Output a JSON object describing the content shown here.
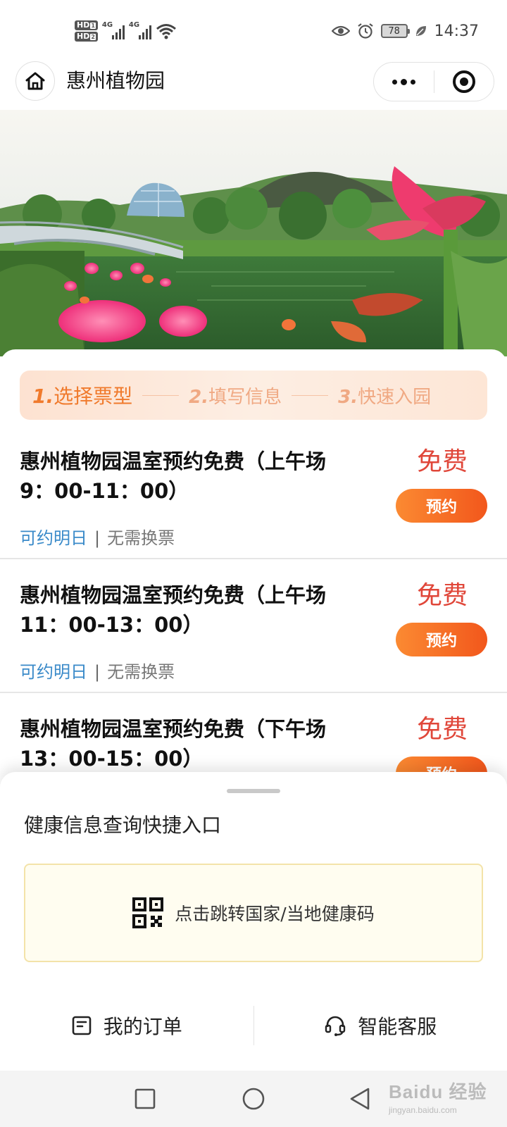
{
  "status_bar": {
    "hd_badges": [
      "HD",
      "HD"
    ],
    "hd_sub": [
      "1",
      "2"
    ],
    "network_labels": [
      "4G",
      "4G"
    ],
    "battery_level": "78",
    "time": "14:37"
  },
  "nav_bar": {
    "title": "惠州植物园",
    "icons": {
      "home": "home-icon",
      "more": "more-dots-icon",
      "close": "target-close-icon"
    }
  },
  "steps": [
    {
      "num": "1.",
      "label": "选择票型",
      "active": true
    },
    {
      "num": "2.",
      "label": "填写信息",
      "active": false
    },
    {
      "num": "3.",
      "label": "快速入园",
      "active": false
    }
  ],
  "tickets": [
    {
      "title": "惠州植物园温室预约免费（上午场9：00-11：00）",
      "price": "免费",
      "button": "预约",
      "tag_primary": "可约明日",
      "tag_separator": "|",
      "tag_secondary": "无需换票"
    },
    {
      "title": "惠州植物园温室预约免费（上午场11：00-13：00）",
      "price": "免费",
      "button": "预约",
      "tag_primary": "可约明日",
      "tag_separator": "|",
      "tag_secondary": "无需换票"
    },
    {
      "title": "惠州植物园温室预约免费（下午场13：00-15：00）",
      "price": "免费",
      "button": "预约",
      "tag_primary": "",
      "tag_separator": "",
      "tag_secondary": ""
    }
  ],
  "health_sheet": {
    "title": "健康信息查询快捷入口",
    "link_text": "点击跳转国家/当地健康码",
    "icon": "qr-code-icon"
  },
  "bottom_bar": {
    "orders": "我的订单",
    "service": "智能客服"
  },
  "watermark": {
    "brand": "Baidu 经验",
    "url": "jingyan.baidu.com"
  },
  "colors": {
    "accent_orange": "#f2571c",
    "price_red": "#e0473a",
    "tag_blue": "#3a8ac9",
    "step_bg": "#fde2d1"
  }
}
